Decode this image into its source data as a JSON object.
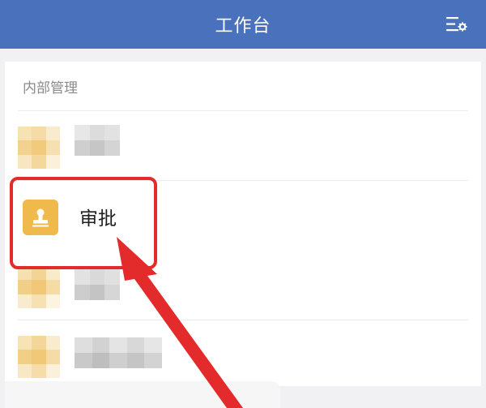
{
  "header": {
    "title": "工作台",
    "settings_icon": "settings-list-icon",
    "background_color": "#4a72bc"
  },
  "section": {
    "title": "内部管理"
  },
  "items": [
    {
      "label": "",
      "icon": "blurred-app-icon"
    },
    {
      "label": "审批",
      "icon": "stamp-icon",
      "icon_color": "#f0b94c"
    },
    {
      "label": "",
      "icon": "blurred-app-icon"
    },
    {
      "label": "",
      "icon": "blurred-app-icon"
    }
  ],
  "annotation": {
    "highlight_color": "#e32b2b",
    "target": "审批"
  }
}
